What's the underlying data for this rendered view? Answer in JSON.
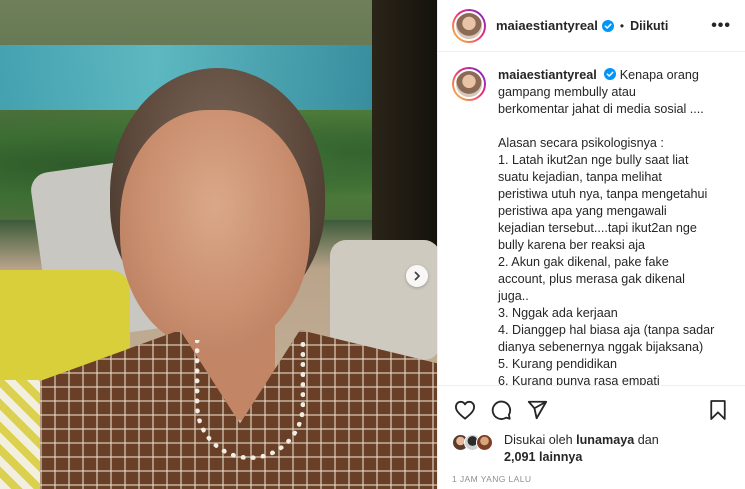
{
  "post": {
    "username": "maiaestiantyreal",
    "follow_state": "Diikuti",
    "separator": "•",
    "more_label": "•••",
    "caption": {
      "username": "maiaestiantyreal",
      "lines": [
        "Kenapa orang",
        "gampang membully atau",
        "berkomentar jahat di media sosial ....",
        "",
        "Alasan secara psikologisnya :",
        "1. Latah ikut2an nge bully saat liat",
        "suatu kejadian, tanpa melihat",
        "peristiwa utuh nya, tanpa mengetahui",
        "peristiwa apa yang mengawali",
        "kejadian tersebut....tapi ikut2an nge",
        "bully karena ber reaksi aja",
        "2. Akun gak dikenal, pake fake",
        "account, plus merasa gak dikenal",
        "juga..",
        "3. Nggak ada kerjaan",
        "4. Dianggep hal biasa aja (tanpa sadar",
        "dianya sebenernya nggak bijaksana)",
        "5. Kurang pendidikan",
        "6. Kurang punya rasa empati"
      ]
    },
    "likes": {
      "prefix": "Disukai oleh",
      "liked_by": "lunamaya",
      "conjunction": "dan",
      "others": "2,091 lainnya"
    },
    "timestamp": "1 JAM YANG LALU"
  },
  "icons": {
    "verified": "verified-badge-icon",
    "like": "heart-icon",
    "comment": "comment-icon",
    "share": "send-icon",
    "save": "bookmark-icon",
    "carousel_next": "chevron-right-icon"
  },
  "colors": {
    "verified_blue": "#0095f6",
    "text": "#262626",
    "muted": "#8e8e8e",
    "border": "#efefef"
  }
}
